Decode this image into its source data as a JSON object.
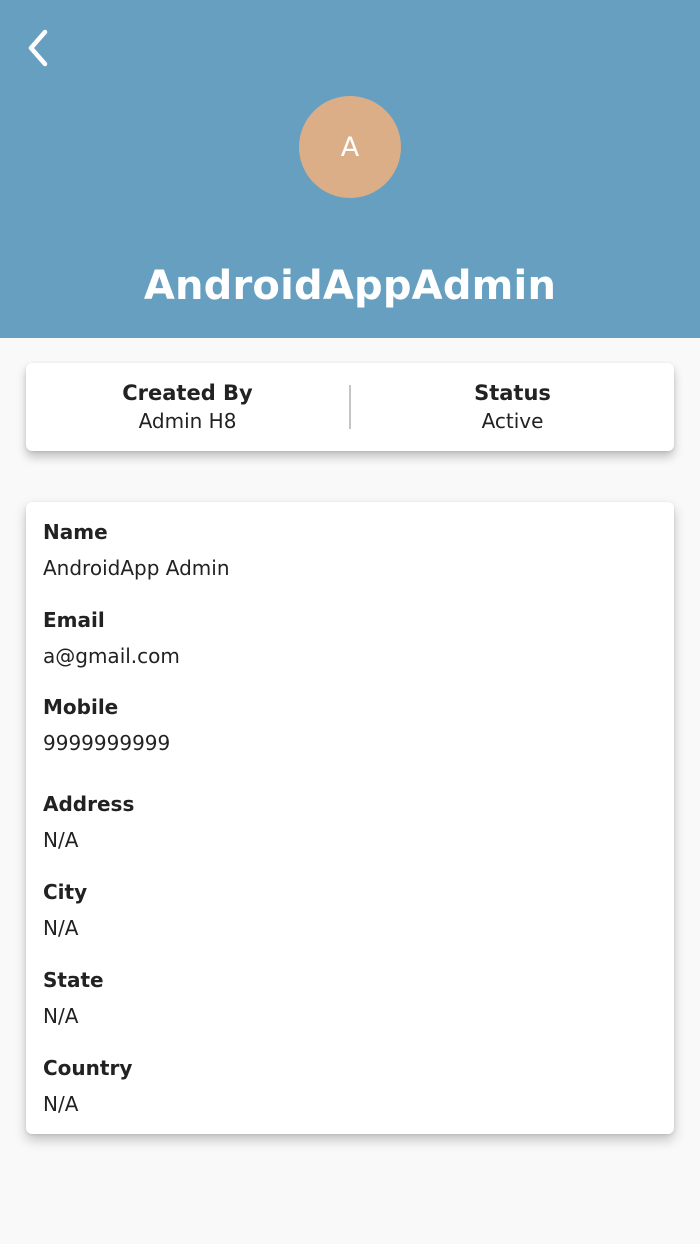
{
  "header": {
    "back_icon": "chevron-left-icon",
    "avatar_letter": "A",
    "title": "AndroidAppAdmin",
    "colors": {
      "header_bg": "#679fc0",
      "avatar_bg": "#dcae87"
    }
  },
  "summary": {
    "created_by_label": "Created By",
    "created_by_value": "Admin H8",
    "status_label": "Status",
    "status_value": "Active"
  },
  "details": {
    "fields": [
      {
        "label": "Name",
        "value": "AndroidApp Admin"
      },
      {
        "label": "Email",
        "value": "a@gmail.com"
      },
      {
        "label": "Mobile",
        "value": "9999999999"
      },
      {
        "label": "Address",
        "value": "N/A"
      },
      {
        "label": "City",
        "value": "N/A"
      },
      {
        "label": "State",
        "value": "N/A"
      },
      {
        "label": "Country",
        "value": "N/A"
      }
    ]
  }
}
